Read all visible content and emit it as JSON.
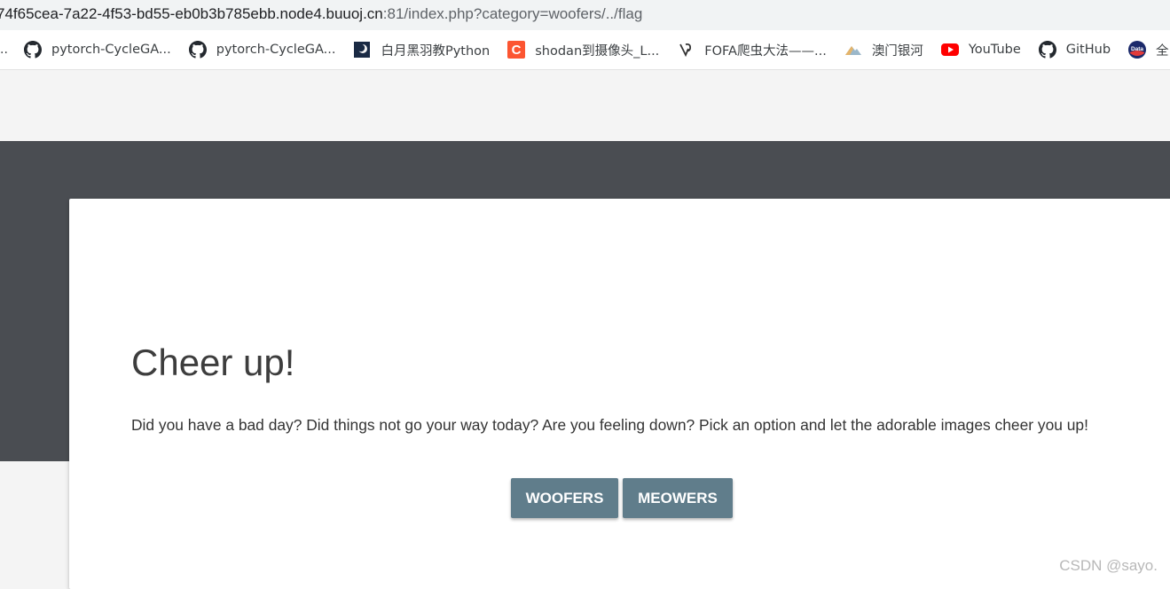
{
  "browser": {
    "url_host": "74f65cea-7a22-4f53-bd55-eb0b3b785ebb.node4.buuoj.cn",
    "url_path": ":81/index.php?category=woofers/../flag",
    "bookmarks_leading": "..",
    "bookmarks": [
      {
        "label": "pytorch-CycleGA...",
        "icon": "github-icon"
      },
      {
        "label": "pytorch-CycleGA...",
        "icon": "github-icon"
      },
      {
        "label": "白月黑羽教Python",
        "icon": "baiyue-icon"
      },
      {
        "label": "shodan到摄像头_L...",
        "icon": "csdn-icon"
      },
      {
        "label": "FOFA爬虫大法——...",
        "icon": "fofa-icon"
      },
      {
        "label": "澳门银河",
        "icon": "mountain-icon"
      },
      {
        "label": "YouTube",
        "icon": "youtube-icon"
      },
      {
        "label": "GitHub",
        "icon": "github-icon"
      },
      {
        "label": "全",
        "icon": "data-icon"
      }
    ]
  },
  "page": {
    "title": "Cheer up!",
    "description": "Did you have a bad day? Did things not go your way today? Are you feeling down? Pick an option and let the adorable images cheer you up!",
    "buttons": {
      "woofers": "WOOFERS",
      "meowers": "MEOWERS"
    }
  },
  "watermark": "CSDN @sayo.",
  "colors": {
    "dark_band": "#4a4d52",
    "button": "#607d8b",
    "youtube": "#ff0000",
    "csdn": "#fc5531"
  }
}
